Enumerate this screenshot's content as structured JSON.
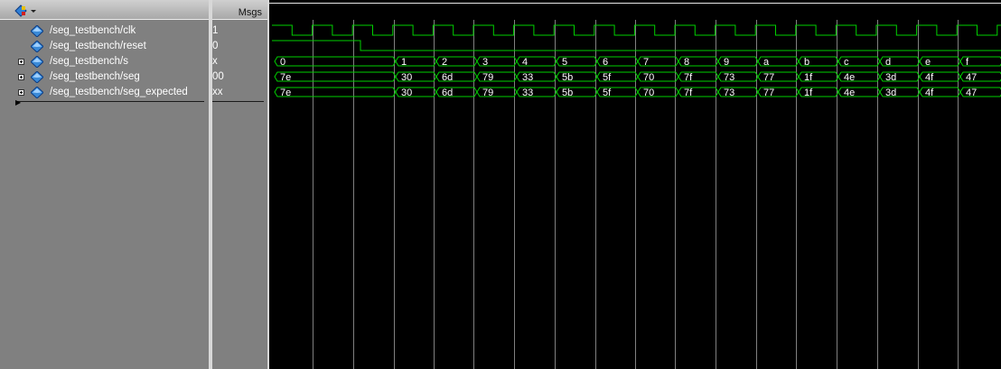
{
  "header": {
    "msgs_label": "Msgs",
    "tool_icon": "wave-select-icon"
  },
  "signals": [
    {
      "name": "/seg_testbench/clk",
      "value": "1",
      "expandable": false,
      "kind": "clock"
    },
    {
      "name": "/seg_testbench/reset",
      "value": "0",
      "expandable": false,
      "kind": "bit"
    },
    {
      "name": "/seg_testbench/s",
      "value": "x",
      "expandable": true,
      "kind": "bus",
      "segments": [
        "0",
        "1",
        "2",
        "3",
        "4",
        "5",
        "6",
        "7",
        "8",
        "9",
        "a",
        "b",
        "c",
        "d",
        "e",
        "f"
      ]
    },
    {
      "name": "/seg_testbench/seg",
      "value": "00",
      "expandable": true,
      "kind": "bus",
      "segments": [
        "7e",
        "30",
        "6d",
        "79",
        "33",
        "5b",
        "5f",
        "70",
        "7f",
        "73",
        "77",
        "1f",
        "4e",
        "3d",
        "4f",
        "47"
      ]
    },
    {
      "name": "/seg_testbench/seg_expected",
      "value": "xx",
      "expandable": true,
      "kind": "bus",
      "segments": [
        "7e",
        "30",
        "6d",
        "79",
        "33",
        "5b",
        "5f",
        "70",
        "7f",
        "73",
        "77",
        "1f",
        "4e",
        "3d",
        "4f",
        "47"
      ]
    }
  ],
  "colors": {
    "wave": "#00d000",
    "grid": "#808080",
    "text": "#ffffff",
    "icon": "#3a8ad8"
  }
}
